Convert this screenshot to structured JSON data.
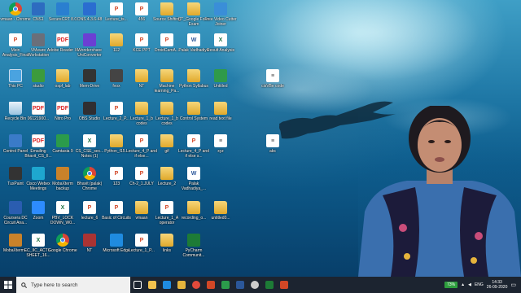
{
  "desktop_icons": [
    {
      "label": "vmaan - Chrome",
      "kind": "chrome",
      "color": "#1a73e8"
    },
    {
      "label": "CNS1",
      "kind": "app",
      "color": "#2d6cc0"
    },
    {
      "label": "SecureCRT 8.0",
      "kind": "app",
      "color": "#2a7fd0"
    },
    {
      "label": "ONS 4.3.6-48",
      "kind": "app",
      "color": "#2a6dd0"
    },
    {
      "label": "Lecture_ts...",
      "kind": "ppt",
      "color": "#d24726"
    },
    {
      "label": "456",
      "kind": "ppt",
      "color": "#d24726"
    },
    {
      "label": "Source Shifting",
      "kind": "folder",
      "color": "#e6b43c"
    },
    {
      "label": "CT_Google Form Exam",
      "kind": "folder",
      "color": "#e6b43c"
    },
    {
      "label": "Free Video Cutter Joiner",
      "kind": "app",
      "color": "#3a8ed8"
    },
    {
      "label": "Mein Analysis_Final",
      "kind": "ppt",
      "color": "#d24726"
    },
    {
      "label": "VMware Workstation",
      "kind": "app",
      "color": "#6a6f7a"
    },
    {
      "label": "Adobe Reader XI",
      "kind": "pdf",
      "color": "#d22"
    },
    {
      "label": "Wondershare UniConverter",
      "kind": "app",
      "color": "#6b3fd3"
    },
    {
      "label": "112",
      "kind": "folder",
      "color": "#e6b43c"
    },
    {
      "label": "KCE PPT",
      "kind": "ppt",
      "color": "#d24726"
    },
    {
      "label": "DroidCamA...",
      "kind": "ppt",
      "color": "#d24726"
    },
    {
      "label": "Palak Vadhadiya",
      "kind": "doc",
      "color": "#2b579a"
    },
    {
      "label": "Result Analysis",
      "kind": "xls",
      "color": "#217346"
    },
    {
      "label": "This PC",
      "kind": "pc",
      "color": "#4aa3e0"
    },
    {
      "label": "studio",
      "kind": "app",
      "color": "#3c9b3c"
    },
    {
      "label": "ospf_lab",
      "kind": "folder",
      "color": "#e6b43c"
    },
    {
      "label": "Mem-Drive",
      "kind": "app",
      "color": "#333"
    },
    {
      "label": "fvox",
      "kind": "app",
      "color": "#444"
    },
    {
      "label": "NT",
      "kind": "folder",
      "color": "#e6b43c"
    },
    {
      "label": "Machine learning_Pa...",
      "kind": "folder",
      "color": "#e6b43c"
    },
    {
      "label": "Python Syllabus",
      "kind": "folder",
      "color": "#e6b43c"
    },
    {
      "label": "Untitled",
      "kind": "app",
      "color": "#2f9a4a"
    },
    {
      "label": "cisVBe code",
      "kind": "txt",
      "color": "#444"
    },
    {
      "label": "Recycle Bin",
      "kind": "bin",
      "color": "#8fb9d8"
    },
    {
      "label": "06121900...",
      "kind": "pdf",
      "color": "#d22"
    },
    {
      "label": "Nitro Pro",
      "kind": "pdf",
      "color": "#d22"
    },
    {
      "label": "OBS Studio",
      "kind": "app",
      "color": "#302e31"
    },
    {
      "label": "Lecture_2_P...",
      "kind": "ppt",
      "color": "#d24726"
    },
    {
      "label": "Lecture_1_b codes",
      "kind": "folder",
      "color": "#e6b43c"
    },
    {
      "label": "Lecture_1_b codes",
      "kind": "folder",
      "color": "#e6b43c"
    },
    {
      "label": "Control System",
      "kind": "folder",
      "color": "#e6b43c"
    },
    {
      "label": "read text file",
      "kind": "folder",
      "color": "#e6b43c"
    },
    {
      "label": "Control Panel",
      "kind": "app",
      "color": "#3a7bc8"
    },
    {
      "label": "Emailing Bhavit_CS_II...",
      "kind": "pdf",
      "color": "#d22"
    },
    {
      "label": "Camtasia 9",
      "kind": "app",
      "color": "#2b9b4b"
    },
    {
      "label": "CS_CSE_sec... Notes (1)",
      "kind": "xls",
      "color": "#217346"
    },
    {
      "label": "Python_f15...",
      "kind": "folder",
      "color": "#e6b43c"
    },
    {
      "label": "Lecture_4_P and if else...",
      "kind": "ppt",
      "color": "#d24726"
    },
    {
      "label": "gif",
      "kind": "folder",
      "color": "#e6b43c"
    },
    {
      "label": "Lecture_4_P and if else s...",
      "kind": "ppt",
      "color": "#d24726"
    },
    {
      "label": "xyz",
      "kind": "txt",
      "color": "#444"
    },
    {
      "label": "abc",
      "kind": "txt",
      "color": "#444"
    },
    {
      "label": "TuxPaint",
      "kind": "app",
      "color": "#333"
    },
    {
      "label": "Cisco Webex Meetings",
      "kind": "app",
      "color": "#1ea7cf"
    },
    {
      "label": "MobaXterm backup",
      "kind": "app",
      "color": "#c9822a"
    },
    {
      "label": "Bhavit (palak) Chrome",
      "kind": "chrome",
      "color": "#1a73e8"
    },
    {
      "label": "123",
      "kind": "ppt",
      "color": "#d24726"
    },
    {
      "label": "Ch-2_1.JULY",
      "kind": "ppt",
      "color": "#d24726"
    },
    {
      "label": "Lecture_2",
      "kind": "folder",
      "color": "#e6b43c"
    },
    {
      "label": "Palak Vadhadiya_...",
      "kind": "doc",
      "color": "#2b579a"
    },
    {
      "label": "Coursera DC Circuit Ana...",
      "kind": "app",
      "color": "#2a5db0"
    },
    {
      "label": "Zoom",
      "kind": "app",
      "color": "#2d8cff"
    },
    {
      "label": "PBV_LOCK DOWN_W0...",
      "kind": "xls",
      "color": "#217346"
    },
    {
      "label": "lecture_6",
      "kind": "ppt",
      "color": "#d24726"
    },
    {
      "label": "Basic of Circuits",
      "kind": "ppt",
      "color": "#d24726"
    },
    {
      "label": "vmaan",
      "kind": "folder",
      "color": "#e6b43c"
    },
    {
      "label": "Lecture_1_A operator",
      "kind": "ppt",
      "color": "#d24726"
    },
    {
      "label": "recording_o...",
      "kind": "folder",
      "color": "#e6b43c"
    },
    {
      "label": "untitled0...",
      "kind": "folder",
      "color": "#e6b43c"
    },
    {
      "label": "MobaXterm...",
      "kind": "app",
      "color": "#c9822a"
    },
    {
      "label": "EC_IIC_ACTI... SHEET_16...",
      "kind": "xls",
      "color": "#217346"
    },
    {
      "label": "Google Chrome",
      "kind": "chrome",
      "color": "#1a73e8"
    },
    {
      "label": "NT",
      "kind": "app",
      "color": "#a33"
    },
    {
      "label": "Microsoft Edge",
      "kind": "app",
      "color": "#1f8be0"
    },
    {
      "label": "Lecture_1_P...",
      "kind": "ppt",
      "color": "#d24726"
    },
    {
      "label": "links",
      "kind": "folder",
      "color": "#e6b43c"
    },
    {
      "label": "PyCharm Communit...",
      "kind": "app",
      "color": "#1d7b36"
    }
  ],
  "taskbar": {
    "search_placeholder": "Type here to search",
    "apps": [
      {
        "name": "task-view",
        "color": "#ffffff"
      },
      {
        "name": "file-explorer",
        "color": "#f2c14e"
      },
      {
        "name": "edge",
        "color": "#1f8be0"
      },
      {
        "name": "folder",
        "color": "#e6b43c"
      },
      {
        "name": "chrome",
        "color": "#e24a3b"
      },
      {
        "name": "powerpoint",
        "color": "#d24726"
      },
      {
        "name": "camtasia",
        "color": "#2b9b4b"
      },
      {
        "name": "word",
        "color": "#2b579a"
      },
      {
        "name": "obs",
        "color": "#cccccc"
      },
      {
        "name": "pycharm",
        "color": "#1d7b36"
      },
      {
        "name": "recorder",
        "color": "#d24726"
      }
    ],
    "battery": "73%",
    "language": "ENG",
    "time": "14:33",
    "date": "26-09-2020"
  }
}
